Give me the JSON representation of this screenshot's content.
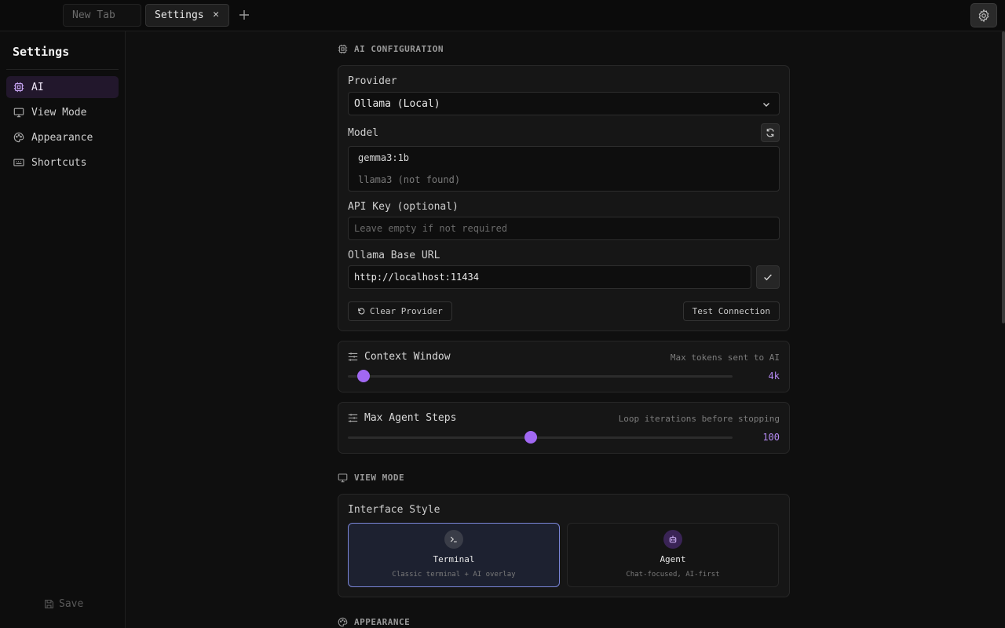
{
  "tabs": [
    {
      "label": "New Tab",
      "active": false
    },
    {
      "label": "Settings",
      "active": true
    }
  ],
  "tab_close_glyph": "✕",
  "tab_add_glyph": "+",
  "sidebar": {
    "title": "Settings",
    "items": [
      {
        "label": "AI",
        "icon": "cpu-icon",
        "active": true
      },
      {
        "label": "View Mode",
        "icon": "monitor-icon",
        "active": false
      },
      {
        "label": "Appearance",
        "icon": "palette-icon",
        "active": false
      },
      {
        "label": "Shortcuts",
        "icon": "keyboard-icon",
        "active": false
      }
    ],
    "save_label": "Save"
  },
  "ai_section": {
    "title": "AI CONFIGURATION",
    "provider_label": "Provider",
    "provider_value": "Ollama (Local)",
    "model_label": "Model",
    "models": [
      {
        "name": "gemma3:1b",
        "available": true
      },
      {
        "name": "llama3 (not found)",
        "available": false
      }
    ],
    "api_key_label": "API Key (optional)",
    "api_key_placeholder": "Leave empty if not required",
    "base_url_label": "Ollama Base URL",
    "base_url_value": "http://localhost:11434",
    "clear_label": "Clear Provider",
    "test_label": "Test Connection"
  },
  "context_window": {
    "label": "Context Window",
    "hint": "Max tokens sent to AI",
    "value_text": "4k",
    "level": 0.04
  },
  "max_agent_steps": {
    "label": "Max Agent Steps",
    "hint": "Loop iterations before stopping",
    "value_text": "100",
    "level": 0.475
  },
  "view_section": {
    "title": "VIEW MODE",
    "interface_label": "Interface Style",
    "modes": [
      {
        "name": "Terminal",
        "desc": "Classic terminal + AI overlay",
        "selected": true
      },
      {
        "name": "Agent",
        "desc": "Chat-focused, AI-first",
        "selected": false
      }
    ]
  },
  "appearance_section": {
    "title": "APPEARANCE"
  },
  "colors": {
    "accent": "#a168f2",
    "selected_border": "#7a86d8",
    "background": "#0f0f0f"
  }
}
